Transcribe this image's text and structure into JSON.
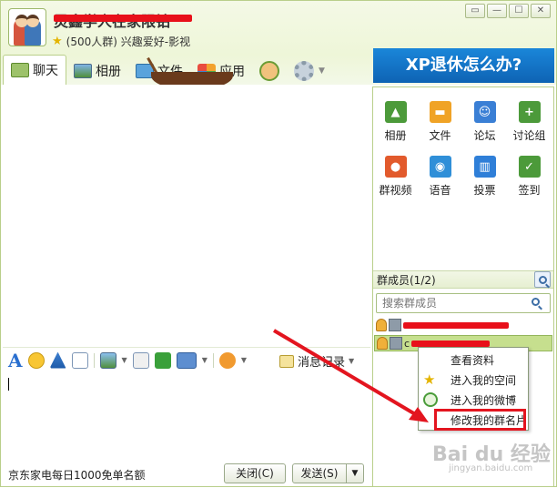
{
  "window": {
    "group_name": "灵鑫学人在家限钻",
    "group_info": "(500人群) 兴趣爱好-影视",
    "controls": [
      "▭",
      "—",
      "☐",
      "✕"
    ]
  },
  "tabs": [
    {
      "label": "聊天"
    },
    {
      "label": "相册"
    },
    {
      "label": "文件"
    },
    {
      "label": "应用"
    }
  ],
  "banner": {
    "text": "XP退休怎么办?"
  },
  "apps": [
    {
      "label": "相册",
      "color": "#4c9a3a",
      "glyph": "▲"
    },
    {
      "label": "文件",
      "color": "#f0a326",
      "glyph": "▬"
    },
    {
      "label": "论坛",
      "color": "#3a7fd5",
      "glyph": "☺"
    },
    {
      "label": "讨论组",
      "color": "#4c9a3a",
      "glyph": "+"
    },
    {
      "label": "群视频",
      "color": "#e25a2c",
      "glyph": "●"
    },
    {
      "label": "语音",
      "color": "#2f8fd8",
      "glyph": "◉"
    },
    {
      "label": "投票",
      "color": "#2f7fd8",
      "glyph": "▥"
    },
    {
      "label": "签到",
      "color": "#4c9a3a",
      "glyph": "✓"
    }
  ],
  "members": {
    "header": "群成员(1/2)",
    "search_placeholder": "搜索群成员",
    "selected_prefix": "c"
  },
  "context_menu": {
    "items": [
      "查看资料",
      "进入我的空间",
      "进入我的微博",
      "修改我的群名片"
    ]
  },
  "toolbar": {
    "font_label": "A",
    "message_log": "消息记录",
    "message_log_caret": "▼"
  },
  "bottom": {
    "ad_text": "京东家电每日1000免单名额",
    "close_button": "关闭(C)",
    "send_button": "发送(S)",
    "send_dropdown": "▼"
  },
  "watermark": {
    "text": "Bai du 经验",
    "sub": "jingyan.baidu.com"
  }
}
